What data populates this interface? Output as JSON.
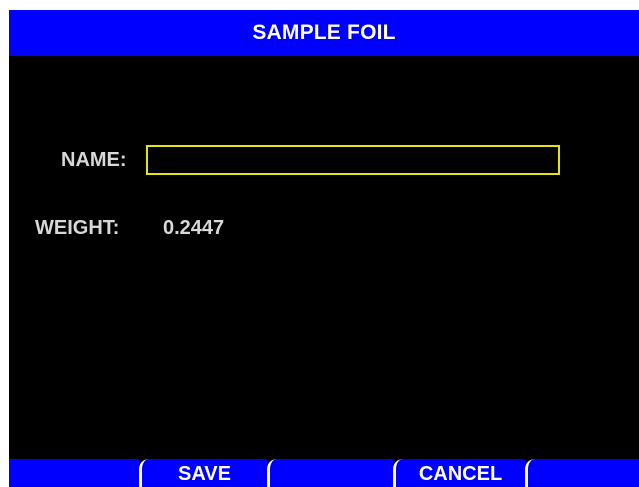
{
  "header": {
    "title": "SAMPLE FOIL"
  },
  "form": {
    "name_label": "NAME:",
    "name_value": "",
    "weight_label": "WEIGHT:",
    "weight_value": "0.2447"
  },
  "softkeys": [
    {
      "label": ""
    },
    {
      "label": "SAVE"
    },
    {
      "label": ""
    },
    {
      "label": "CANCEL"
    },
    {
      "label": ""
    }
  ],
  "colors": {
    "background": "#000000",
    "title_bar": "#0000ff",
    "softkey": "#0000ff",
    "input_border": "#e6e600",
    "text": "#d8d8d8"
  }
}
